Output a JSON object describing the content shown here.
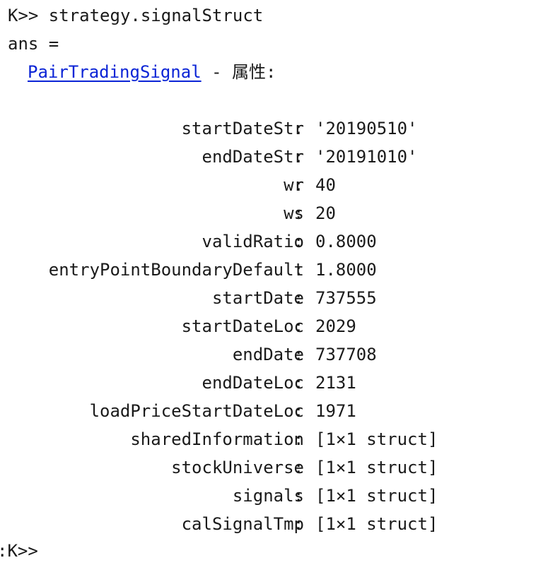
{
  "console": {
    "prompt": "K>>",
    "command": " strategy.signalStruct",
    "ans_line": "ans =",
    "class_name": "PairTradingSignal",
    "class_suffix": " - 属性:",
    "final_prompt": ":K>>"
  },
  "properties": [
    {
      "name": "startDateStr",
      "value": "'20190510'"
    },
    {
      "name": "endDateStr",
      "value": "'20191010'"
    },
    {
      "name": "wr",
      "value": "40"
    },
    {
      "name": "ws",
      "value": "20"
    },
    {
      "name": "validRatio",
      "value": "0.8000"
    },
    {
      "name": "entryPointBoundaryDefault",
      "value": "1.8000"
    },
    {
      "name": "startDate",
      "value": "737555"
    },
    {
      "name": "startDateLoc",
      "value": "2029"
    },
    {
      "name": "endDate",
      "value": "737708"
    },
    {
      "name": "endDateLoc",
      "value": "2131"
    },
    {
      "name": "loadPriceStartDateLoc",
      "value": "1971"
    },
    {
      "name": "sharedInformation",
      "value": "[1×1 struct]"
    },
    {
      "name": "stockUniverse",
      "value": "[1×1 struct]"
    },
    {
      "name": "signals",
      "value": "[1×1 struct]"
    },
    {
      "name": "calSignalTmp",
      "value": "[1×1 struct]"
    }
  ]
}
